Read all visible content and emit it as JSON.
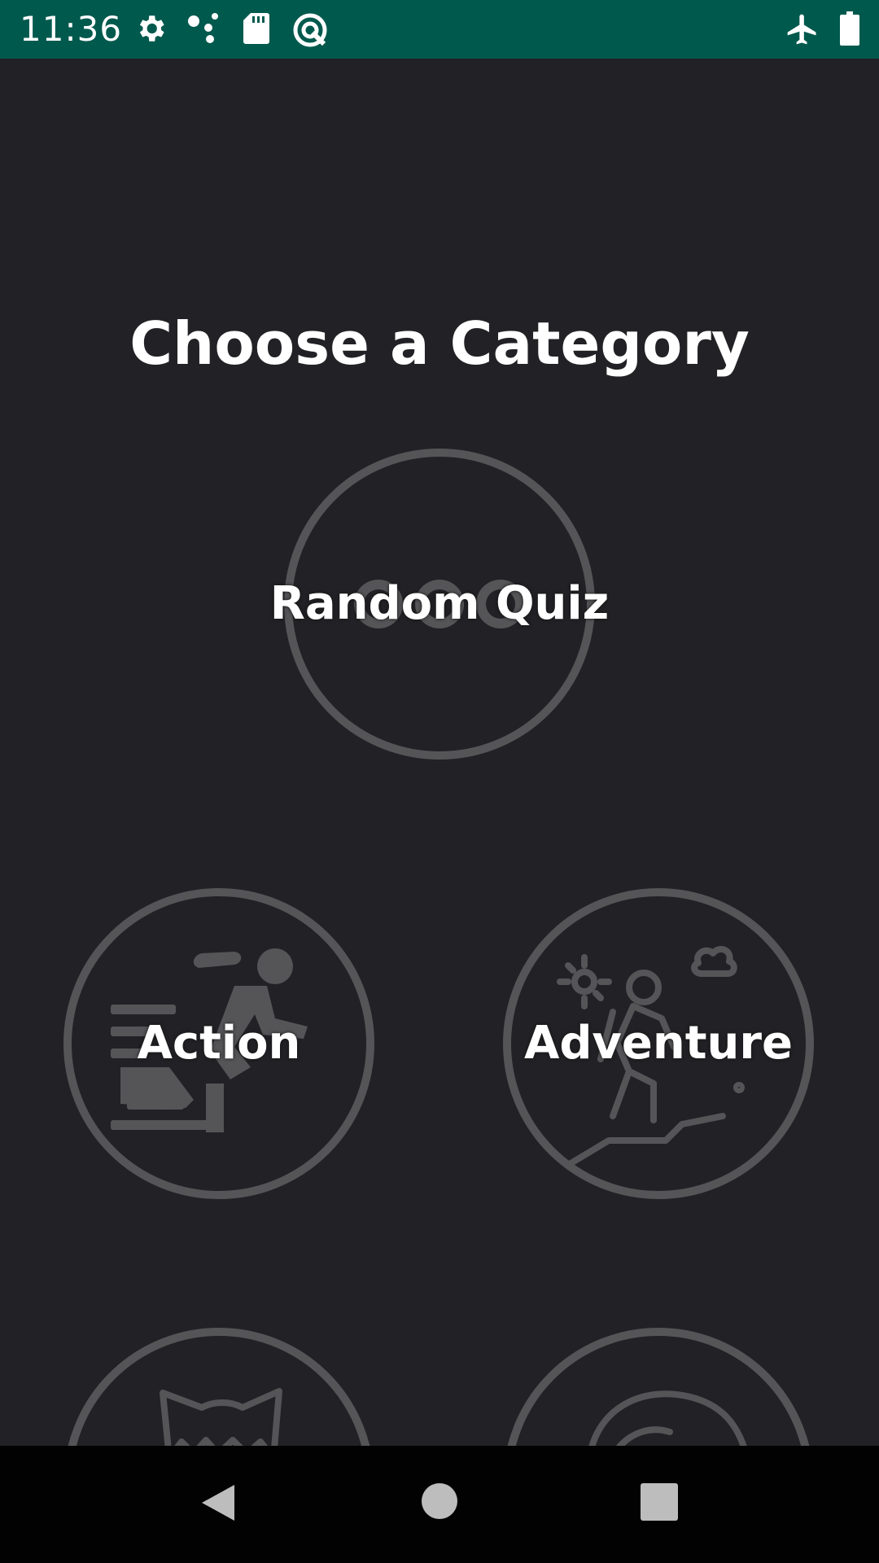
{
  "status_bar": {
    "time": "11:36",
    "icons": [
      "settings-icon",
      "assistant-dots-icon",
      "sd-card-icon",
      "data-saver-icon",
      "airplane-mode-icon",
      "battery-icon"
    ],
    "background_color": "#00594d"
  },
  "main": {
    "title": "Choose a Category",
    "categories": [
      {
        "label": "Random Quiz",
        "icon": "random-dice-icon"
      },
      {
        "label": "Action",
        "icon": "action-runner-icon"
      },
      {
        "label": "Adventure",
        "icon": "adventure-hiker-icon"
      },
      {
        "label": "",
        "icon": "cat-icon"
      },
      {
        "label": "",
        "icon": "character-face-icon"
      }
    ],
    "background_color": "#222125",
    "ring_color": "#555457"
  },
  "nav_bar": {
    "buttons": [
      "back-icon",
      "home-icon",
      "recents-icon"
    ]
  }
}
